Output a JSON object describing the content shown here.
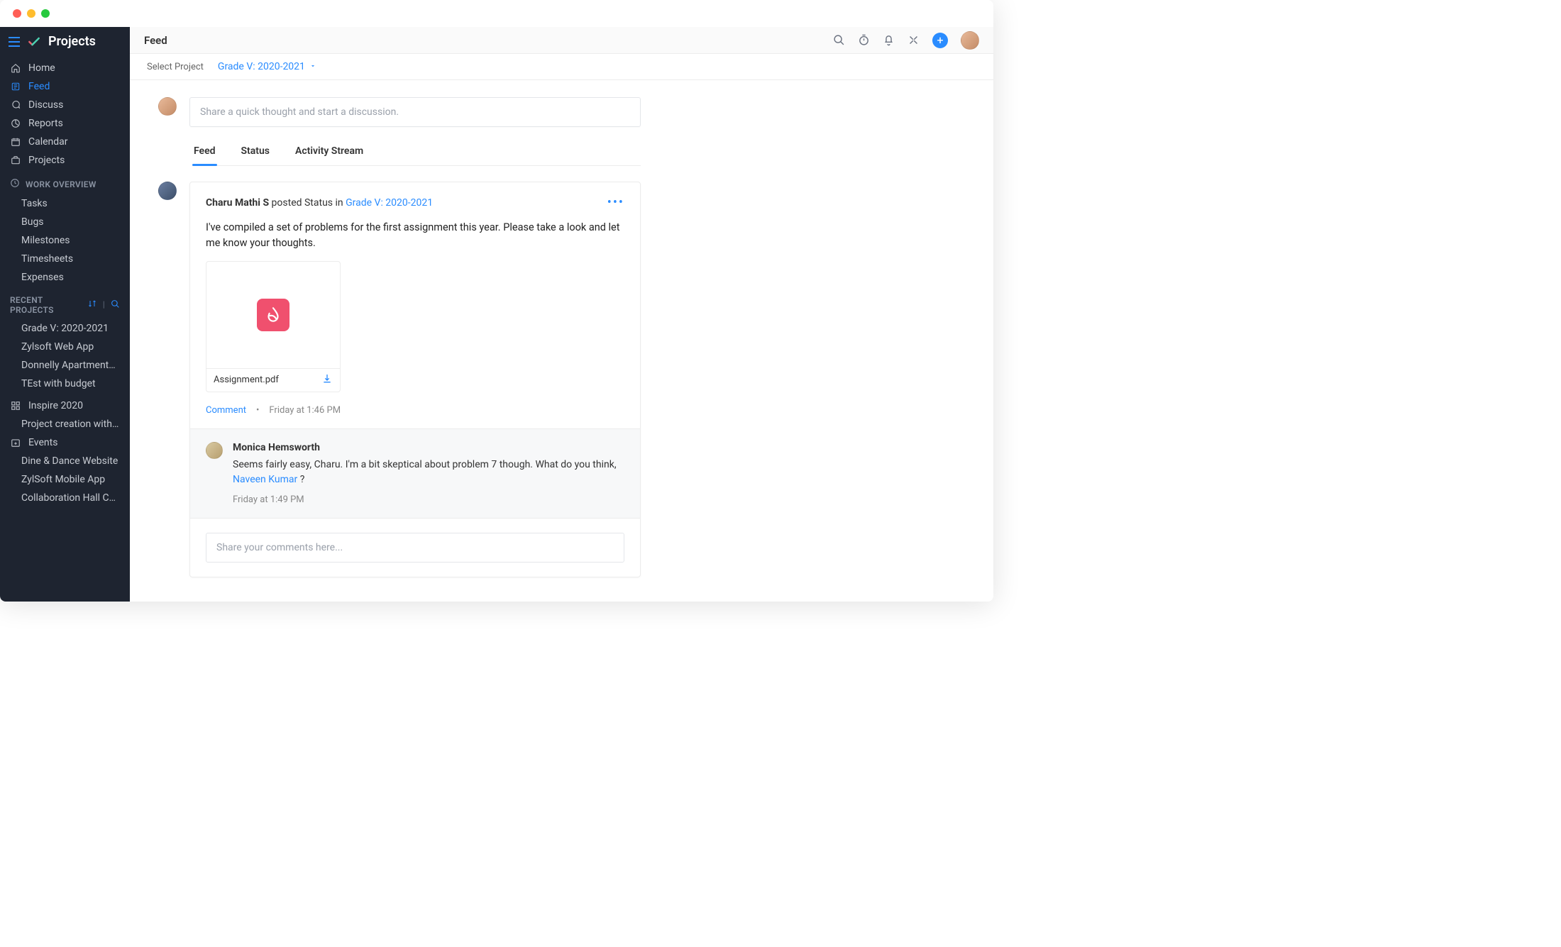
{
  "brand": {
    "title": "Projects"
  },
  "sidebar": {
    "main_nav": [
      {
        "label": "Home",
        "icon": "home"
      },
      {
        "label": "Feed",
        "icon": "feed",
        "active": true
      },
      {
        "label": "Discuss",
        "icon": "discuss"
      },
      {
        "label": "Reports",
        "icon": "reports"
      },
      {
        "label": "Calendar",
        "icon": "calendar"
      },
      {
        "label": "Projects",
        "icon": "projects"
      }
    ],
    "work_section_label": "WORK OVERVIEW",
    "work_items": [
      {
        "label": "Tasks"
      },
      {
        "label": "Bugs"
      },
      {
        "label": "Milestones"
      },
      {
        "label": "Timesheets"
      },
      {
        "label": "Expenses"
      }
    ],
    "recent_label": "RECENT PROJECTS",
    "recent_items": [
      {
        "label": "Grade V: 2020-2021"
      },
      {
        "label": "Zylsoft Web App"
      },
      {
        "label": "Donnelly Apartments Co"
      },
      {
        "label": "TEst with budget"
      }
    ],
    "inspire_label": "Inspire 2020",
    "inspire_sub": [
      {
        "label": "Project creation with lay"
      }
    ],
    "events_label": "Events",
    "events_sub": [
      {
        "label": "Dine & Dance Website"
      },
      {
        "label": "ZylSoft Mobile App"
      },
      {
        "label": "Collaboration Hall Const"
      }
    ]
  },
  "header": {
    "page_title": "Feed"
  },
  "selector": {
    "label": "Select Project",
    "value": "Grade V: 2020-2021"
  },
  "compose": {
    "placeholder": "Share a quick thought and start a discussion."
  },
  "tabs": [
    {
      "label": "Feed",
      "active": true
    },
    {
      "label": "Status"
    },
    {
      "label": "Activity Stream"
    }
  ],
  "post": {
    "author": "Charu Mathi S",
    "verb": " posted Status in ",
    "project_link": "Grade V: 2020-2021",
    "body": "I've compiled a set of problems for the first assignment this year. Please take a look and let me know your thoughts.",
    "attachment_name": "Assignment.pdf",
    "comment_action": "Comment",
    "timestamp": "Friday at 1:46 PM"
  },
  "comment": {
    "author": "Monica Hemsworth",
    "text_before_mention": "Seems fairly easy, Charu. I'm a bit skeptical about problem 7 though. What do you think, ",
    "mention": "Naveen Kumar",
    "text_after_mention": "  ?",
    "timestamp": "Friday at 1:49 PM"
  },
  "reply": {
    "placeholder": "Share your comments here..."
  }
}
